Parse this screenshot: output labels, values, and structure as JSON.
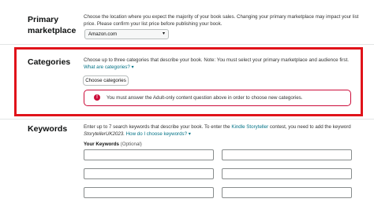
{
  "primary_marketplace": {
    "label_line1": "Primary",
    "label_line2": "marketplace",
    "desc_line1": "Choose the location where you expect the majority of your book sales. Changing your primary marketplace may impact your list",
    "desc_line2": "price. Please confirm your list price before publishing your book.",
    "selected": "Amazon.com",
    "chevron_icon": "chevron-down-icon"
  },
  "categories": {
    "label": "Categories",
    "desc": "Choose up to three categories that describe your book. Note: You must select your primary marketplace and audience first.",
    "link": "What are categories?",
    "link_icon": "chevron-down-icon",
    "button": "Choose categories",
    "error_icon": "alert-icon",
    "error_icon_glyph": "!",
    "error": "You must answer the Adult-only content question above in order to choose new categories.",
    "highlight_color": "#e0131a"
  },
  "keywords": {
    "label": "Keywords",
    "desc_part1": "Enter up to 7 search keywords that describe your book. To enter the",
    "desc_link": "Kindle Storyteller",
    "desc_part2": "contest, you need to add the keyword",
    "desc_line2": "StorytellerUK2023.",
    "help_link": "How do I choose keywords?",
    "field_label": "Your Keywords",
    "field_optional": "(Optional)"
  }
}
